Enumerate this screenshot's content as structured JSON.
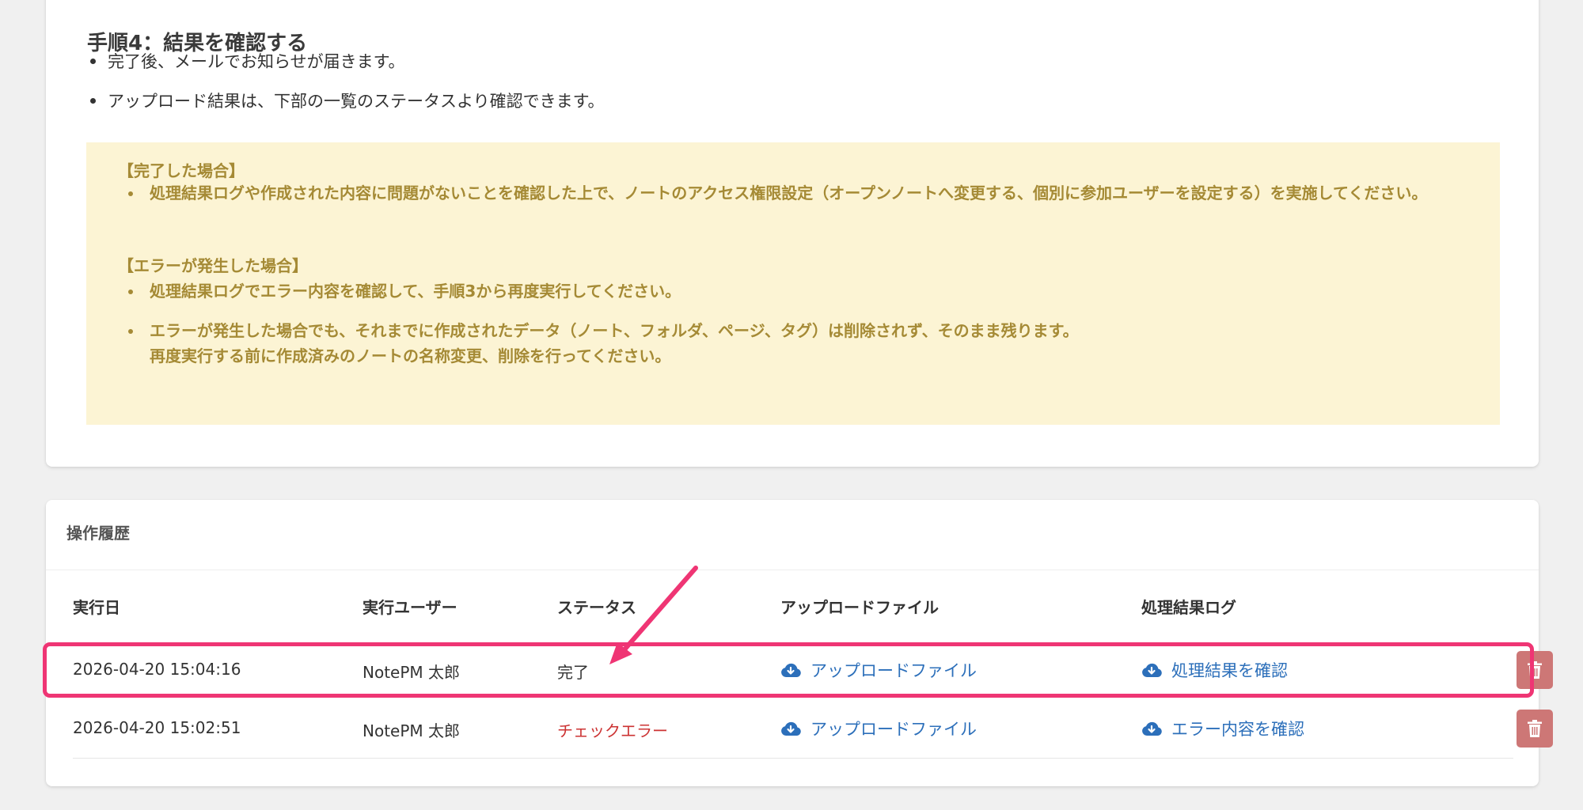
{
  "step4": {
    "title": "手順4：結果を確認する",
    "bullets": [
      "完了後、メールでお知らせが届きます。",
      "アップロード結果は、下部の一覧のステータスより確認できます。"
    ]
  },
  "notice": {
    "success_heading": "【完了した場合】",
    "success_items": [
      "処理結果ログや作成された内容に問題がないことを確認した上で、ノートのアクセス権限設定（オープンノートへ変更する、個別に参加ユーザーを設定する）を実施してください。"
    ],
    "error_heading": "【エラーが発生した場合】",
    "error_items": [
      "処理結果ログでエラー内容を確認して、手順3から再度実行してください。",
      "エラーが発生した場合でも、それまでに作成されたデータ（ノート、フォルダ、ページ、タグ）は削除されず、そのまま残ります。\n再度実行する前に作成済みのノートの名称変更、削除を行ってください。"
    ]
  },
  "history": {
    "title": "操作履歴",
    "columns": [
      "実行日",
      "実行ユーザー",
      "ステータス",
      "アップロードファイル",
      "処理結果ログ"
    ],
    "rows": [
      {
        "date": "2026-04-20 15:04:16",
        "user": "NotePM 太郎",
        "status": "完了",
        "upload": "アップロードファイル",
        "log": "処理結果を確認"
      },
      {
        "date": "2026-04-20 15:02:51",
        "user": "NotePM 太郎",
        "status": "チェックエラー",
        "upload": "アップロードファイル",
        "log": "エラー内容を確認"
      }
    ]
  },
  "colors": {
    "link": "#2c6fba",
    "error": "#cc3333",
    "notice_bg": "#fcf4d4",
    "notice_text": "#a58a35",
    "highlight": "#ef3574",
    "delete_button": "#cd7776"
  },
  "icons": {
    "download": "cloud-download-icon",
    "delete": "trash-icon"
  }
}
